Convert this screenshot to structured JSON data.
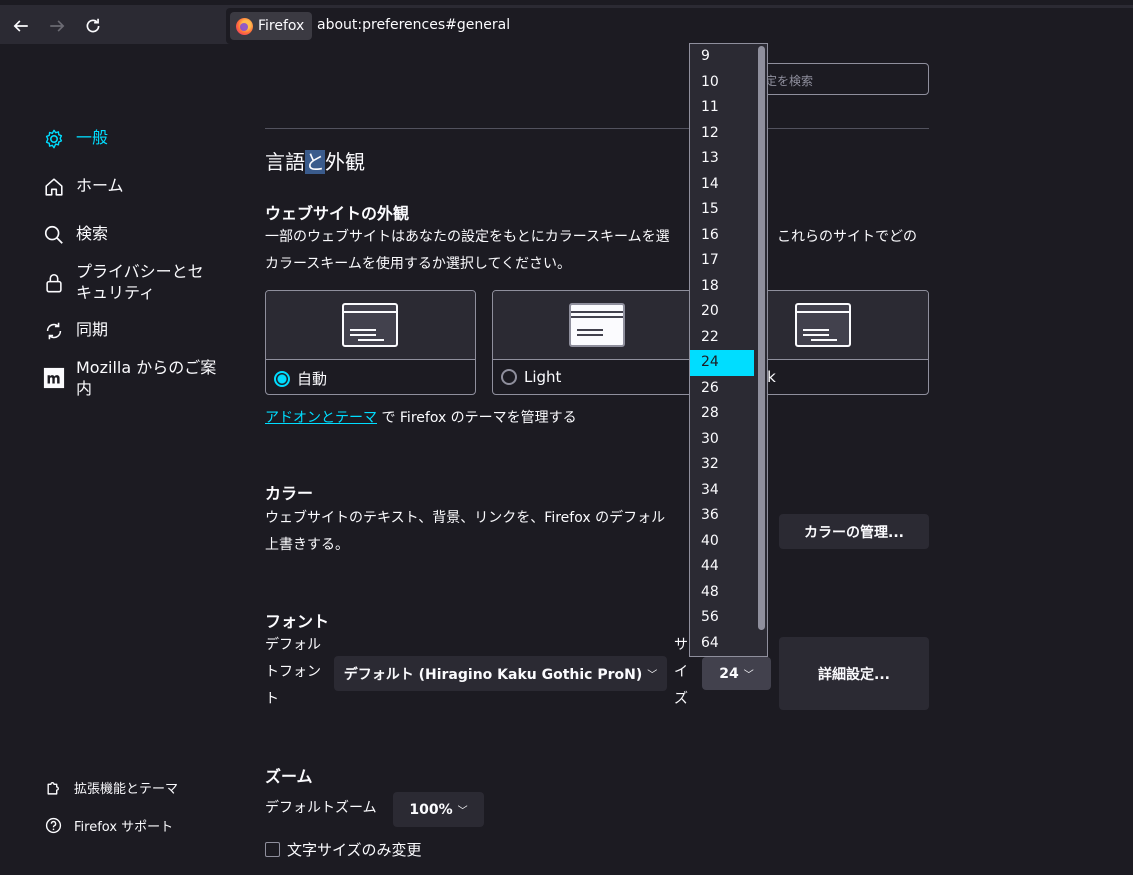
{
  "toolbar": {
    "identity_label": "Firefox",
    "url": "about:preferences#general"
  },
  "sidebar": {
    "items": [
      {
        "label": "一般",
        "icon": "gear-icon"
      },
      {
        "label": "ホーム",
        "icon": "home-icon"
      },
      {
        "label": "検索",
        "icon": "search-icon"
      },
      {
        "label": "プライバシーとセキュリティ",
        "icon": "lock-icon"
      },
      {
        "label": "同期",
        "icon": "sync-icon"
      },
      {
        "label": "Mozilla からのご案内",
        "icon": "mozilla-icon"
      }
    ],
    "footer": [
      {
        "label": "拡張機能とテーマ",
        "icon": "puzzle-icon"
      },
      {
        "label": "Firefox サポート",
        "icon": "help-icon"
      }
    ]
  },
  "search": {
    "placeholder": "定を検索"
  },
  "main": {
    "section_title_pre": "言語",
    "section_title_hl": "と",
    "section_title_post": "外観",
    "website_appearance": {
      "title": "ウェブサイトの外観",
      "desc_line1": "一部のウェブサイトはあなたの設定をもとにカラースキームを選",
      "desc_line1b": "これらのサイトでどの",
      "desc_line2": "カラースキームを使用するか選択してください。",
      "options": [
        {
          "label": "自動",
          "selected": true
        },
        {
          "label": "Light",
          "selected": false
        },
        {
          "label": "rk",
          "selected": false
        }
      ],
      "addon_link": "アドオンとテーマ",
      "addon_suffix": " で Firefox のテーマを管理する"
    },
    "colors": {
      "title": "カラー",
      "desc_line1": "ウェブサイトのテキスト、背景、リンクを、Firefox のデフォル",
      "desc_line2": "上書きする。",
      "manage_button": "カラーの管理..."
    },
    "fonts": {
      "title": "フォント",
      "default_font_label": [
        "デフォル",
        "トフォン",
        "ト"
      ],
      "default_font_value": "デフォルト (Hiragino Kaku Gothic ProN)",
      "size_label": [
        "サ",
        "イ",
        "ズ"
      ],
      "size_value": "24",
      "advanced_button": "詳細設定..."
    },
    "zoom": {
      "title": "ズーム",
      "default_zoom_label": "デフォルトズーム",
      "default_zoom_value": "100%",
      "text_only_label": "文字サイズのみ変更"
    }
  },
  "dropdown": {
    "options": [
      "9",
      "10",
      "11",
      "12",
      "13",
      "14",
      "15",
      "16",
      "17",
      "18",
      "20",
      "22",
      "24",
      "26",
      "28",
      "30",
      "32",
      "34",
      "36",
      "40",
      "44",
      "48",
      "56",
      "64"
    ],
    "selected": "24"
  },
  "colors": {
    "accent": "#00ddff",
    "background": "#1c1b22",
    "surface": "#2b2a33"
  }
}
